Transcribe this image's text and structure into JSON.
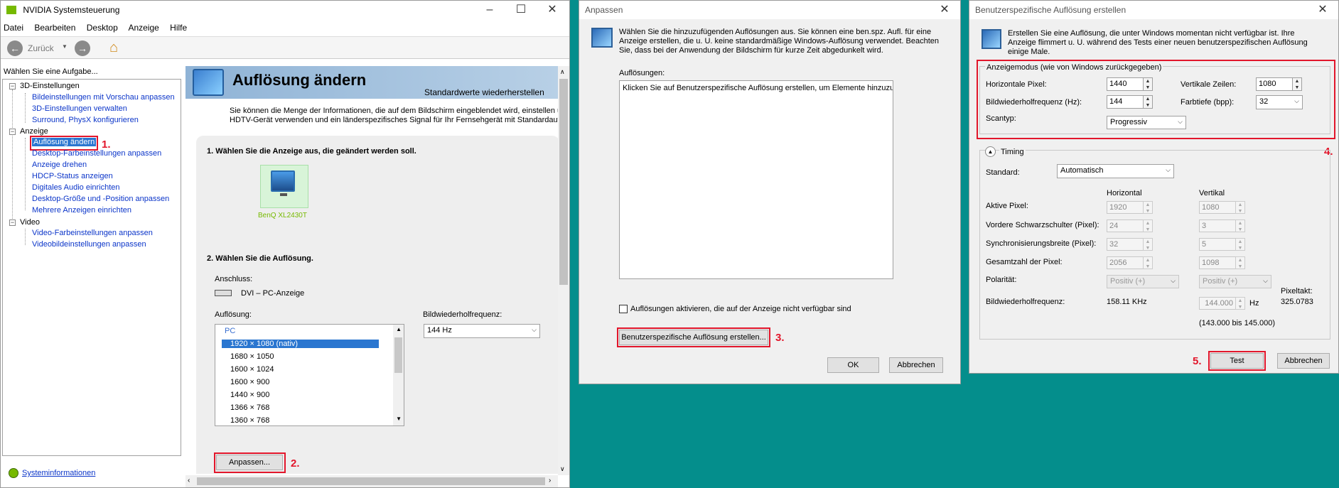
{
  "nvidia": {
    "title": "NVIDIA Systemsteuerung",
    "menu": [
      "Datei",
      "Bearbeiten",
      "Desktop",
      "Anzeige",
      "Hilfe"
    ],
    "back_label": "Zurück",
    "task_label": "Wählen Sie eine Aufgabe...",
    "tree": [
      {
        "label": "3D-Einstellungen",
        "group": true
      },
      {
        "label": "Bildeinstellungen mit Vorschau anpassen"
      },
      {
        "label": "3D-Einstellungen verwalten"
      },
      {
        "label": "Surround, PhysX konfigurieren"
      },
      {
        "label": "Anzeige",
        "group": true
      },
      {
        "label": "Auflösung ändern",
        "selected": true
      },
      {
        "label": "Desktop-Farbeinstellungen anpassen"
      },
      {
        "label": "Anzeige drehen"
      },
      {
        "label": "HDCP-Status anzeigen"
      },
      {
        "label": "Digitales Audio einrichten"
      },
      {
        "label": "Desktop-Größe und -Position anpassen"
      },
      {
        "label": "Mehrere Anzeigen einrichten"
      },
      {
        "label": "Video",
        "group": true
      },
      {
        "label": "Video-Farbeinstellungen anpassen"
      },
      {
        "label": "Videobildeinstellungen anpassen"
      }
    ],
    "sysinfo": "Systeminformationen",
    "page_title": "Auflösung ändern",
    "restore": "Standardwerte wiederherstellen",
    "desc_line1": "Sie können die Menge der Informationen, die auf dem Bildschirm eingeblendet wird, einstellen und",
    "desc_line2": "HDTV-Gerät verwenden und ein länderspezifisches Signal für Ihr Fernsehgerät mit Standardauflös",
    "step1": "1. Wählen Sie die Anzeige aus, die geändert werden soll.",
    "monitor_name": "BenQ XL2430T",
    "step2": "2. Wählen Sie die Auflösung.",
    "connection_label": "Anschluss:",
    "connection_value": "DVI – PC-Anzeige",
    "resolution_label": "Auflösung:",
    "refresh_label": "Bildwiederholfrequenz:",
    "refresh_value": "144 Hz",
    "list_header": "PC",
    "resolutions": [
      "1920 × 1080 (nativ)",
      "1680 × 1050",
      "1600 × 1024",
      "1600 × 900",
      "1440 × 900",
      "1366 × 768",
      "1360 × 768"
    ],
    "anpassen_button": "Anpassen..."
  },
  "annotations": {
    "n1": "1.",
    "n2": "2.",
    "n3": "3.",
    "n4": "4.",
    "n5": "5."
  },
  "anpassen": {
    "title": "Anpassen",
    "intro1": "Wählen Sie die hinzuzufügenden Auflösungen aus. Sie können eine ben.spz. Aufl. für eine",
    "intro2": "Anzeige erstellen, die u. U. keine standardmäßige Windows-Auflösung verwendet. Beachten",
    "intro3": "Sie, dass bei der Anwendung der Bildschirm für kurze Zeit abgedunkelt wird.",
    "list_label": "Auflösungen:",
    "list_text": "Klicken Sie auf Benutzerspezifische Auflösung erstellen, um Elemente hinzuzufü",
    "checkbox_label": "Auflösungen aktivieren, die auf der Anzeige nicht verfügbar sind",
    "create_button": "Benutzerspezifische Auflösung erstellen...",
    "ok_button": "OK",
    "cancel_button": "Abbrechen"
  },
  "custom": {
    "title": "Benutzerspezifische Auflösung erstellen",
    "intro1": "Erstellen Sie eine Auflösung, die unter Windows momentan nicht verfügbar ist. Ihre",
    "intro2": "Anzeige flimmert u. U. während des Tests einer neuen benutzerspezifischen Auflösung",
    "intro3": "einige Male.",
    "mode_group": "Anzeigemodus (wie von Windows zurückgegeben)",
    "h_pixels_label": "Horizontale Pixel:",
    "h_pixels": "1440",
    "v_lines_label": "Vertikale Zeilen:",
    "v_lines": "1080",
    "refresh_label": "Bildwiederholfrequenz (Hz):",
    "refresh": "144",
    "depth_label": "Farbtiefe (bpp):",
    "depth": "32",
    "scan_label": "Scantyp:",
    "scan": "Progressiv",
    "timing_label": "Timing",
    "standard_label": "Standard:",
    "standard": "Automatisch",
    "col_h": "Horizontal",
    "col_v": "Vertikal",
    "rows": [
      {
        "label": "Aktive Pixel:",
        "h": "1920",
        "v": "1080"
      },
      {
        "label": "Vordere Schwarzschulter (Pixel):",
        "h": "24",
        "v": "3"
      },
      {
        "label": "Synchronisierungsbreite (Pixel):",
        "h": "32",
        "v": "5"
      },
      {
        "label": "Gesamtzahl der Pixel:",
        "h": "2056",
        "v": "1098"
      }
    ],
    "polarity_label": "Polarität:",
    "polarity_h": "Positiv (+)",
    "polarity_v": "Positiv (+)",
    "pixelclock_label": "Pixeltakt:",
    "pixelclock": "325.0783",
    "freq_label": "Bildwiederholfrequenz:",
    "freq_h": "158.11 KHz",
    "freq_v": "144.000",
    "freq_unit": "Hz",
    "range": "(143.000 bis 145.000)",
    "test_button": "Test",
    "cancel_button": "Abbrechen"
  }
}
